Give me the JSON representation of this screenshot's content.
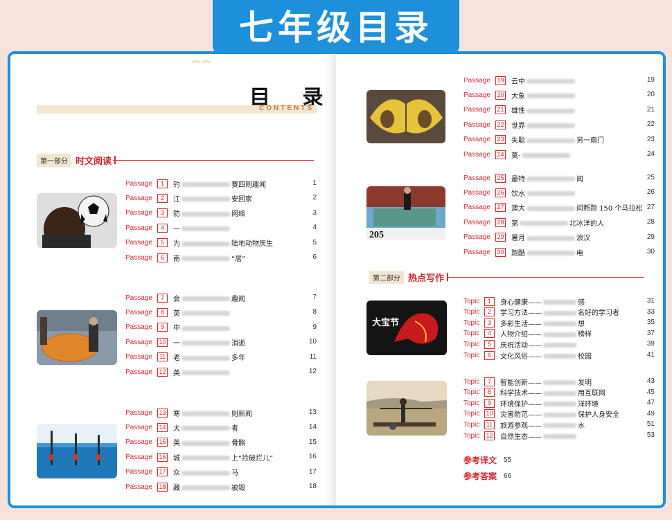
{
  "banner": {
    "title": "七年级目录"
  },
  "left": {
    "heading": "目 录",
    "contents_label": "CONTENTS",
    "section1": {
      "tag": "第一部分",
      "title": "时文阅读"
    },
    "groups": [
      {
        "items": [
          {
            "label": "Passage",
            "num": "1",
            "prefix": "钓",
            "suffix": "赛四则趣闻",
            "page": "1"
          },
          {
            "label": "Passage",
            "num": "2",
            "prefix": "江",
            "suffix": "安回家",
            "page": "2"
          },
          {
            "label": "Passage",
            "num": "3",
            "prefix": "防",
            "suffix": "网络",
            "page": "3"
          },
          {
            "label": "Passage",
            "num": "4",
            "prefix": "一",
            "suffix": "",
            "page": "4"
          },
          {
            "label": "Passage",
            "num": "5",
            "prefix": "为",
            "suffix": "陆地动物庆生",
            "page": "5"
          },
          {
            "label": "Passage",
            "num": "6",
            "prefix": "南",
            "suffix": "“居”",
            "page": "6"
          }
        ]
      },
      {
        "items": [
          {
            "label": "Passage",
            "num": "7",
            "prefix": "会",
            "suffix": "趣闻",
            "page": "7"
          },
          {
            "label": "Passage",
            "num": "8",
            "prefix": "英",
            "suffix": "",
            "page": "8"
          },
          {
            "label": "Passage",
            "num": "9",
            "prefix": "中",
            "suffix": "",
            "page": "9"
          },
          {
            "label": "Passage",
            "num": "10",
            "prefix": "一",
            "suffix": "消逝",
            "page": "10"
          },
          {
            "label": "Passage",
            "num": "11",
            "prefix": "老",
            "suffix": "多年",
            "page": "11"
          },
          {
            "label": "Passage",
            "num": "12",
            "prefix": "英",
            "suffix": "",
            "page": "12"
          }
        ]
      },
      {
        "items": [
          {
            "label": "Passage",
            "num": "13",
            "prefix": "寒",
            "suffix": "则新闻",
            "page": "13"
          },
          {
            "label": "Passage",
            "num": "14",
            "prefix": "大",
            "suffix": "者",
            "page": "14"
          },
          {
            "label": "Passage",
            "num": "15",
            "prefix": "英",
            "suffix": "骨骼",
            "page": "15"
          },
          {
            "label": "Passage",
            "num": "16",
            "prefix": "城",
            "suffix": "上“捡破烂儿”",
            "page": "16"
          },
          {
            "label": "Passage",
            "num": "17",
            "prefix": "众",
            "suffix": "马",
            "page": "17"
          },
          {
            "label": "Passage",
            "num": "18",
            "prefix": "藏",
            "suffix": "被毁",
            "page": "18"
          }
        ]
      }
    ]
  },
  "right": {
    "groups": [
      {
        "items": [
          {
            "label": "Passage",
            "num": "19",
            "prefix": "云中",
            "suffix": "",
            "page": "19"
          },
          {
            "label": "Passage",
            "num": "20",
            "prefix": "大象",
            "suffix": "",
            "page": "20"
          },
          {
            "label": "Passage",
            "num": "21",
            "prefix": "雄性",
            "suffix": "",
            "page": "21"
          },
          {
            "label": "Passage",
            "num": "22",
            "prefix": "世界",
            "suffix": "",
            "page": "22"
          },
          {
            "label": "Passage",
            "num": "23",
            "prefix": "失聪",
            "suffix": "另一扇门",
            "page": "23"
          },
          {
            "label": "Passage",
            "num": "24",
            "prefix": "莫·",
            "suffix": "",
            "page": "24"
          }
        ]
      },
      {
        "items": [
          {
            "label": "Passage",
            "num": "25",
            "prefix": "最特",
            "suffix": "闻",
            "page": "25"
          },
          {
            "label": "Passage",
            "num": "26",
            "prefix": "饮水",
            "suffix": "",
            "page": "26"
          },
          {
            "label": "Passage",
            "num": "27",
            "prefix": "澳大",
            "suffix": "间断跑 150 个马拉松",
            "page": "27"
          },
          {
            "label": "Passage",
            "num": "28",
            "prefix": "第",
            "suffix": "北冰洋的人",
            "page": "28"
          },
          {
            "label": "Passage",
            "num": "29",
            "prefix": "暑月",
            "suffix": "浪汉",
            "page": "29"
          },
          {
            "label": "Passage",
            "num": "30",
            "prefix": "跑酷",
            "suffix": "电",
            "page": "30"
          }
        ]
      }
    ],
    "section2": {
      "tag": "第二部分",
      "title": "热点写作"
    },
    "topic_groups": [
      {
        "items": [
          {
            "label": "Topic",
            "num": "1",
            "prefix": "身心健康——",
            "suffix": "感",
            "page": "31"
          },
          {
            "label": "Topic",
            "num": "2",
            "prefix": "学习方法——",
            "suffix": "名好的学习者",
            "page": "33"
          },
          {
            "label": "Topic",
            "num": "3",
            "prefix": "多彩生活——",
            "suffix": "想",
            "page": "35"
          },
          {
            "label": "Topic",
            "num": "4",
            "prefix": "人物介绍——",
            "suffix": "榜样",
            "page": "37"
          },
          {
            "label": "Topic",
            "num": "5",
            "prefix": "庆祝活动——",
            "suffix": "",
            "page": "39"
          },
          {
            "label": "Topic",
            "num": "6",
            "prefix": "文化风俗——",
            "suffix": "校园",
            "page": "41"
          }
        ]
      },
      {
        "items": [
          {
            "label": "Topic",
            "num": "7",
            "prefix": "智能创新——",
            "suffix": "发明",
            "page": "43"
          },
          {
            "label": "Topic",
            "num": "8",
            "prefix": "科学技术——",
            "suffix": "用互联网",
            "page": "45"
          },
          {
            "label": "Topic",
            "num": "9",
            "prefix": "环境保护——",
            "suffix": "洋环境",
            "page": "47"
          },
          {
            "label": "Topic",
            "num": "10",
            "prefix": "灾害防范——",
            "suffix": "保护人身安全",
            "page": "49"
          },
          {
            "label": "Topic",
            "num": "11",
            "prefix": "旅游参观——",
            "suffix": "水",
            "page": "51"
          },
          {
            "label": "Topic",
            "num": "12",
            "prefix": "自然生态——",
            "suffix": "",
            "page": "53"
          }
        ]
      }
    ],
    "refs": [
      {
        "title": "参考译文",
        "page": "55"
      },
      {
        "title": "参考答案",
        "page": "66"
      }
    ]
  },
  "photo_labels": {
    "pumpkin_number": "205",
    "dragon_caption": "大宝节"
  },
  "colors": {
    "brand_blue": "#1e8fdb",
    "accent_red": "#d4282f",
    "bg": "#f7e3dc"
  }
}
